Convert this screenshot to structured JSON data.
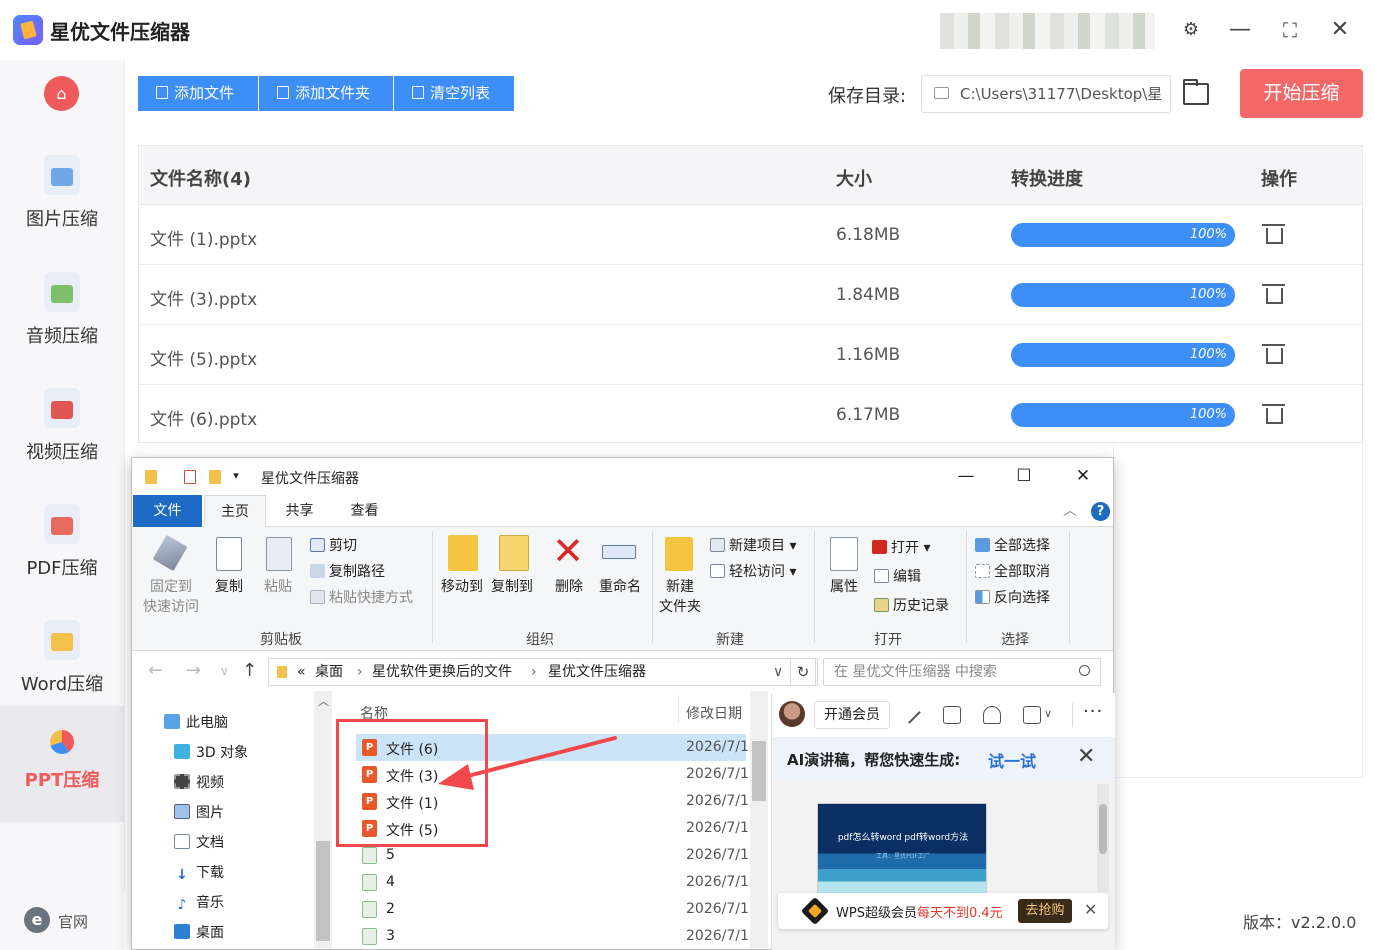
{
  "app": {
    "title": "星优文件压缩器",
    "version": "版本：v2.2.0.0",
    "accent": "#3d8ef7",
    "danger": "#f46868"
  },
  "sidebar": {
    "items": [
      {
        "label": "图片压缩",
        "icon": "image-compress-icon"
      },
      {
        "label": "音频压缩",
        "icon": "audio-compress-icon"
      },
      {
        "label": "视频压缩",
        "icon": "video-compress-icon"
      },
      {
        "label": "PDF压缩",
        "icon": "pdf-compress-icon"
      },
      {
        "label": "Word压缩",
        "icon": "word-compress-icon"
      },
      {
        "label": "PPT压缩",
        "icon": "ppt-compress-icon",
        "active": true
      }
    ],
    "footer_site": "官网",
    "footer_site_icon": "e"
  },
  "toolbar": {
    "add_file": "添加文件",
    "add_folder": "添加文件夹",
    "clear_list": "清空列表",
    "save_label": "保存目录:",
    "save_path": "C:\\Users\\31177\\Desktop\\星",
    "start": "开始压缩"
  },
  "table": {
    "headers": [
      "文件名称(4)",
      "大小",
      "转换进度",
      "操作"
    ],
    "rows": [
      {
        "name": "文件 (1).pptx",
        "size": "6.18MB",
        "progress": "100%"
      },
      {
        "name": "文件 (3).pptx",
        "size": "1.84MB",
        "progress": "100%"
      },
      {
        "name": "文件 (5).pptx",
        "size": "1.16MB",
        "progress": "100%"
      },
      {
        "name": "文件 (6).pptx",
        "size": "6.17MB",
        "progress": "100%"
      }
    ]
  },
  "explorer": {
    "title": "星优文件压缩器",
    "tabs": [
      "文件",
      "主页",
      "共享",
      "查看"
    ],
    "help": "?",
    "ribbon": {
      "clipboard": {
        "pin": "固定到\n快速访问",
        "copy": "复制",
        "paste": "粘贴",
        "cut": "剪切",
        "copy_path": "复制路径",
        "paste_shortcut": "粘贴快捷方式",
        "group": "剪贴板"
      },
      "organize": {
        "move_to": "移动到",
        "copy_to": "复制到",
        "delete": "删除",
        "rename": "重命名",
        "group": "组织"
      },
      "new": {
        "new_folder": "新建\n文件夹",
        "new_item": "新建项目",
        "easy_access": "轻松访问",
        "group": "新建"
      },
      "open": {
        "properties": "属性",
        "open": "打开",
        "edit": "编辑",
        "history": "历史记录",
        "group": "打开"
      },
      "select": {
        "select_all": "全部选择",
        "select_none": "全部取消",
        "invert": "反向选择",
        "group": "选择"
      }
    },
    "address": {
      "prefix": "«",
      "crumbs": [
        "桌面",
        "星优软件更换后的文件",
        "星优文件压缩器"
      ],
      "search_placeholder": "在 星优文件压缩器 中搜索"
    },
    "nav": [
      "此电脑",
      "3D 对象",
      "视频",
      "图片",
      "文档",
      "下载",
      "音乐",
      "桌面"
    ],
    "columns": {
      "name": "名称",
      "modified": "修改日期"
    },
    "files": [
      {
        "name": "文件 (6)",
        "date": "2026/7/1",
        "type": "ppt",
        "selected": true
      },
      {
        "name": "文件 (3)",
        "date": "2026/7/1",
        "type": "ppt"
      },
      {
        "name": "文件 (1)",
        "date": "2026/7/1",
        "type": "ppt"
      },
      {
        "name": "文件 (5)",
        "date": "2026/7/1",
        "type": "ppt"
      },
      {
        "name": "5",
        "date": "2026/7/1",
        "type": "generic"
      },
      {
        "name": "4",
        "date": "2026/7/1",
        "type": "generic"
      },
      {
        "name": "2",
        "date": "2026/7/1",
        "type": "generic"
      },
      {
        "name": "3",
        "date": "2026/7/1",
        "type": "generic"
      }
    ]
  },
  "wps": {
    "vip_button": "开通会员",
    "ai_text": "AI演讲稿，帮您快速生成:",
    "ai_try": "试一试",
    "thumb_title": "pdf怎么转word pdf转word方法",
    "thumb_sub": "工具：星优PDF工厂",
    "promo_text": "WPS超级会员",
    "promo_highlight": "每天不到0.4元",
    "promo_button": "去抢购"
  }
}
